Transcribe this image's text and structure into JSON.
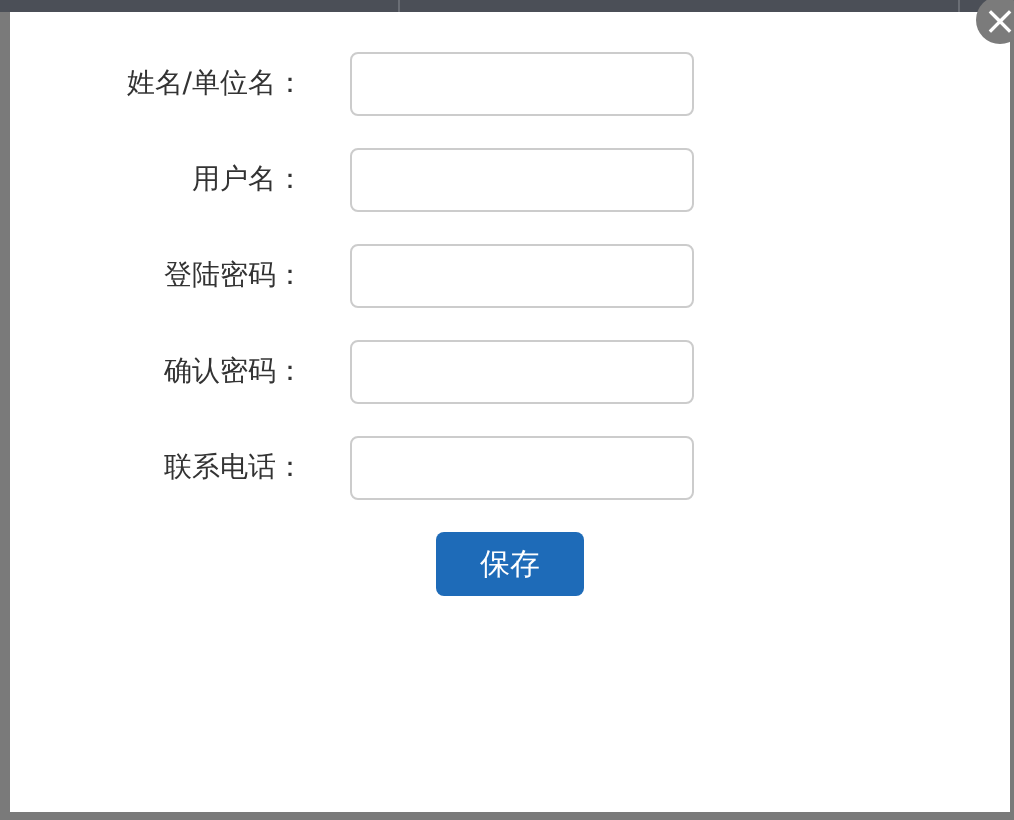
{
  "fields": [
    {
      "label": "姓名/单位名："
    },
    {
      "label": "用户名："
    },
    {
      "label": "登陆密码："
    },
    {
      "label": "确认密码："
    },
    {
      "label": "联系电话："
    }
  ],
  "close_button": {
    "text": "×"
  },
  "save_button": {
    "text": "保存"
  }
}
